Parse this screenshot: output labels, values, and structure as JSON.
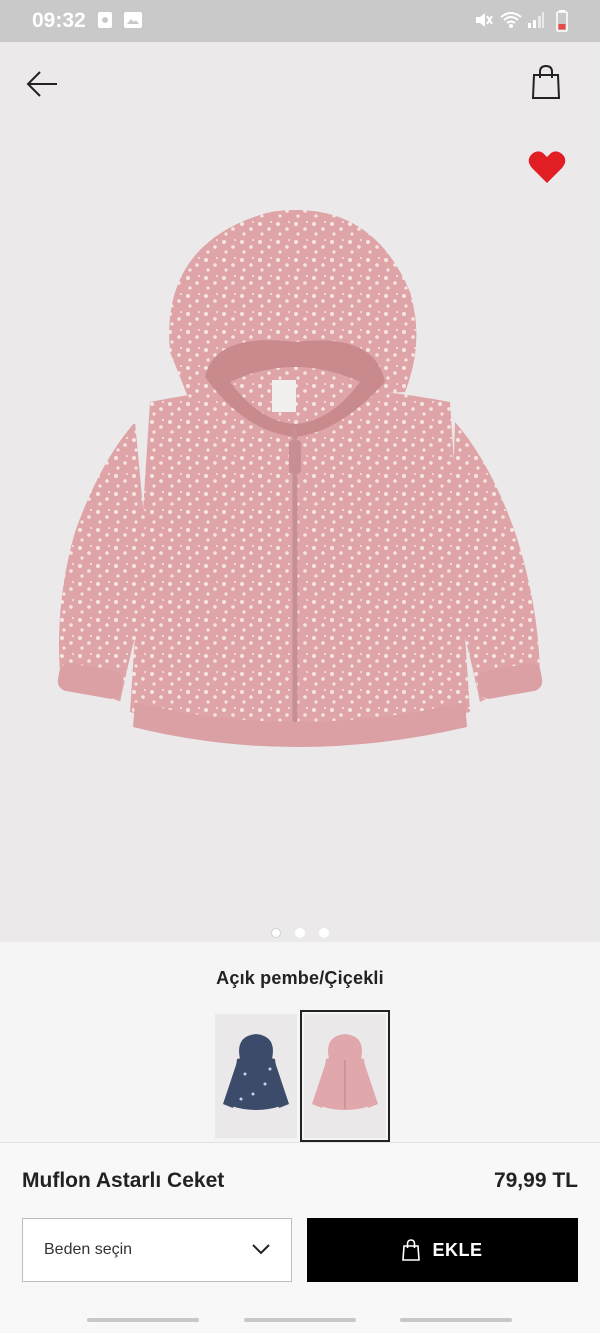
{
  "status_bar": {
    "time": "09:32"
  },
  "product": {
    "color_name": "Açık pembe/Çiçekli",
    "name": "Muflon Astarlı Ceket",
    "price": "79,99 TL"
  },
  "gallery": {
    "image_count": 3,
    "active_index": 0
  },
  "actions": {
    "size_placeholder": "Beden seçin",
    "add_label": "EKLE"
  },
  "colors": {
    "accent": "#000000",
    "heart": "#e01e24",
    "jacket": "#e0a8ac",
    "navy_variant": "#3d4b6b"
  },
  "icons": [
    "back-arrow-icon",
    "shopping-bag-icon",
    "heart-icon",
    "chevron-down-icon",
    "bag-icon"
  ]
}
